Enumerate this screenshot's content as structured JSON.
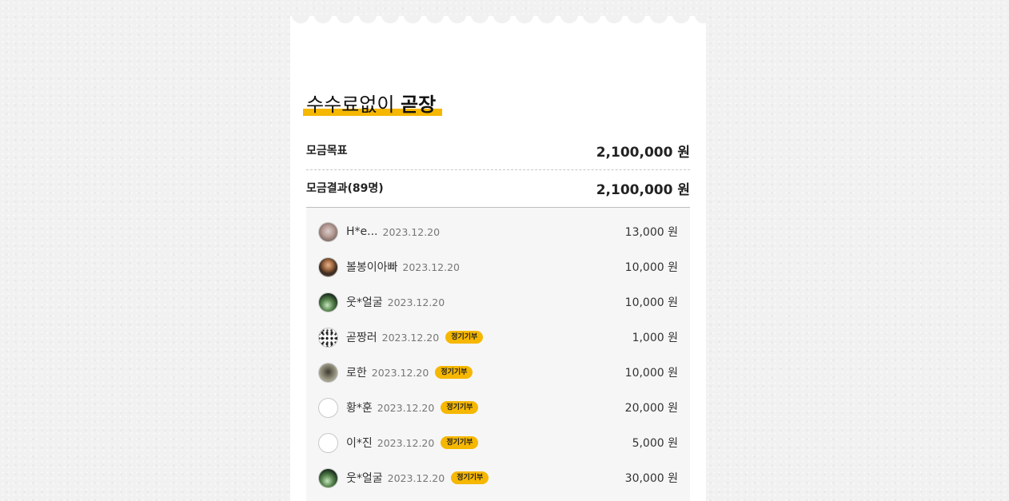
{
  "campaign": {
    "title_main": "수수료없이 ",
    "title_bold": "곧장",
    "accent_color": "#f6b700"
  },
  "summary": {
    "goal_label": "모금목표",
    "goal_value": "2,100,000 원",
    "result_label": "모금결과(89명)",
    "result_value": "2,100,000 원"
  },
  "donors": [
    {
      "name": "H*e...",
      "date": "2023.12.20",
      "badge": "",
      "amount": "13,000 원",
      "avatar": "photo-blur"
    },
    {
      "name": "볼봉이아빠",
      "date": "2023.12.20",
      "badge": "",
      "amount": "10,000 원",
      "avatar": "photo-person"
    },
    {
      "name": "웃*얼굴",
      "date": "2023.12.20",
      "badge": "",
      "amount": "10,000 원",
      "avatar": "photo-plant"
    },
    {
      "name": "곧짱러",
      "date": "2023.12.20",
      "badge": "정기기부",
      "amount": "1,000 원",
      "avatar": "photo-dalmatian"
    },
    {
      "name": "로한",
      "date": "2023.12.20",
      "badge": "정기기부",
      "amount": "10,000 원",
      "avatar": "photo-outdoor"
    },
    {
      "name": "황*훈",
      "date": "2023.12.20",
      "badge": "정기기부",
      "amount": "20,000 원",
      "avatar": "empty"
    },
    {
      "name": "이*진",
      "date": "2023.12.20",
      "badge": "정기기부",
      "amount": "5,000 원",
      "avatar": "empty"
    },
    {
      "name": "웃*얼굴",
      "date": "2023.12.20",
      "badge": "정기기부",
      "amount": "30,000 원",
      "avatar": "photo-plant"
    }
  ]
}
